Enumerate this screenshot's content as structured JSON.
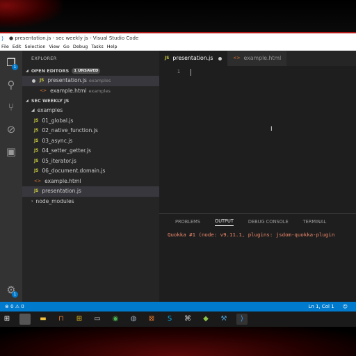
{
  "window": {
    "title": "● presentation.js - sec weekly js - Visual Studio Code"
  },
  "menu": [
    "File",
    "Edit",
    "Selection",
    "View",
    "Go",
    "Debug",
    "Tasks",
    "Help"
  ],
  "activity": {
    "explorer_badge": "1",
    "settings_badge": "1"
  },
  "explorer": {
    "title": "EXPLORER",
    "open_editors": {
      "heading": "OPEN EDITORS",
      "badge": "1 UNSAVED",
      "items": [
        {
          "name": "presentation.js",
          "folder": "examples",
          "type": "js"
        },
        {
          "name": "example.html",
          "folder": "examples",
          "type": "html"
        }
      ]
    },
    "workspace": {
      "heading": "SEC WEEKLY JS",
      "folder": "examples",
      "files": [
        {
          "name": "01_global.js",
          "type": "js"
        },
        {
          "name": "02_native_function.js",
          "type": "js"
        },
        {
          "name": "03_async.js",
          "type": "js"
        },
        {
          "name": "04_setter_getter.js",
          "type": "js"
        },
        {
          "name": "05_iterator.js",
          "type": "js"
        },
        {
          "name": "06_document.domain.js",
          "type": "js"
        },
        {
          "name": "example.html",
          "type": "html"
        },
        {
          "name": "presentation.js",
          "type": "js"
        }
      ],
      "collapsed_folder": "node_modules"
    }
  },
  "icons": {
    "js": "JS",
    "html": "<>"
  },
  "editor": {
    "tabs": [
      {
        "label": "presentation.js",
        "active": true,
        "dirty": true
      },
      {
        "label": "example.html",
        "active": false,
        "dirty": false
      }
    ],
    "line_number": "1"
  },
  "panel": {
    "tabs": [
      "PROBLEMS",
      "OUTPUT",
      "DEBUG CONSOLE",
      "TERMINAL"
    ],
    "output": "Quokka #1 (node: v9.11.1, plugins: jsdom-quokka-plugin"
  },
  "status": {
    "errors": "0",
    "warnings": "0",
    "position": "Ln 1, Col 1"
  },
  "colors": {
    "accent": "#007acc",
    "js": "#cbcb41",
    "html": "#e37933",
    "output_text": "#f08a6c"
  }
}
